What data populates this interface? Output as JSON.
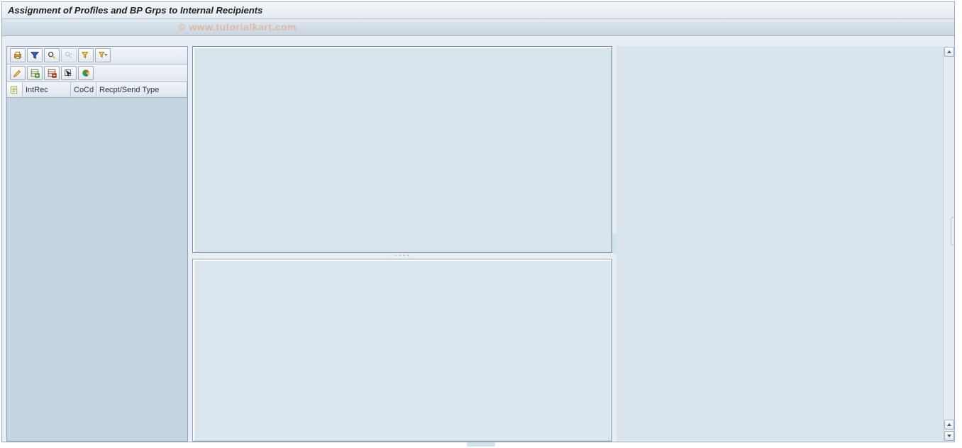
{
  "window": {
    "title": "Assignment of Profiles and BP Grps to Internal Recipients"
  },
  "watermark": "© www.tutorialkart.com",
  "toolbar_row1": {
    "btn1": "print-icon",
    "btn2": "filter-funnel-icon",
    "btn3": "find-icon",
    "btn4": "find-next-icon",
    "btn5": "filter-icon",
    "btn6": "filter-dropdown-icon"
  },
  "toolbar_row2": {
    "btn1": "edit-icon",
    "btn2": "insert-row-icon",
    "btn3": "delete-row-icon",
    "btn4": "select-icon",
    "btn5": "graphic-icon"
  },
  "table": {
    "columns": {
      "c1": "IntRec",
      "c2": "CoCd",
      "c3": "Recpt/Send Type"
    }
  }
}
